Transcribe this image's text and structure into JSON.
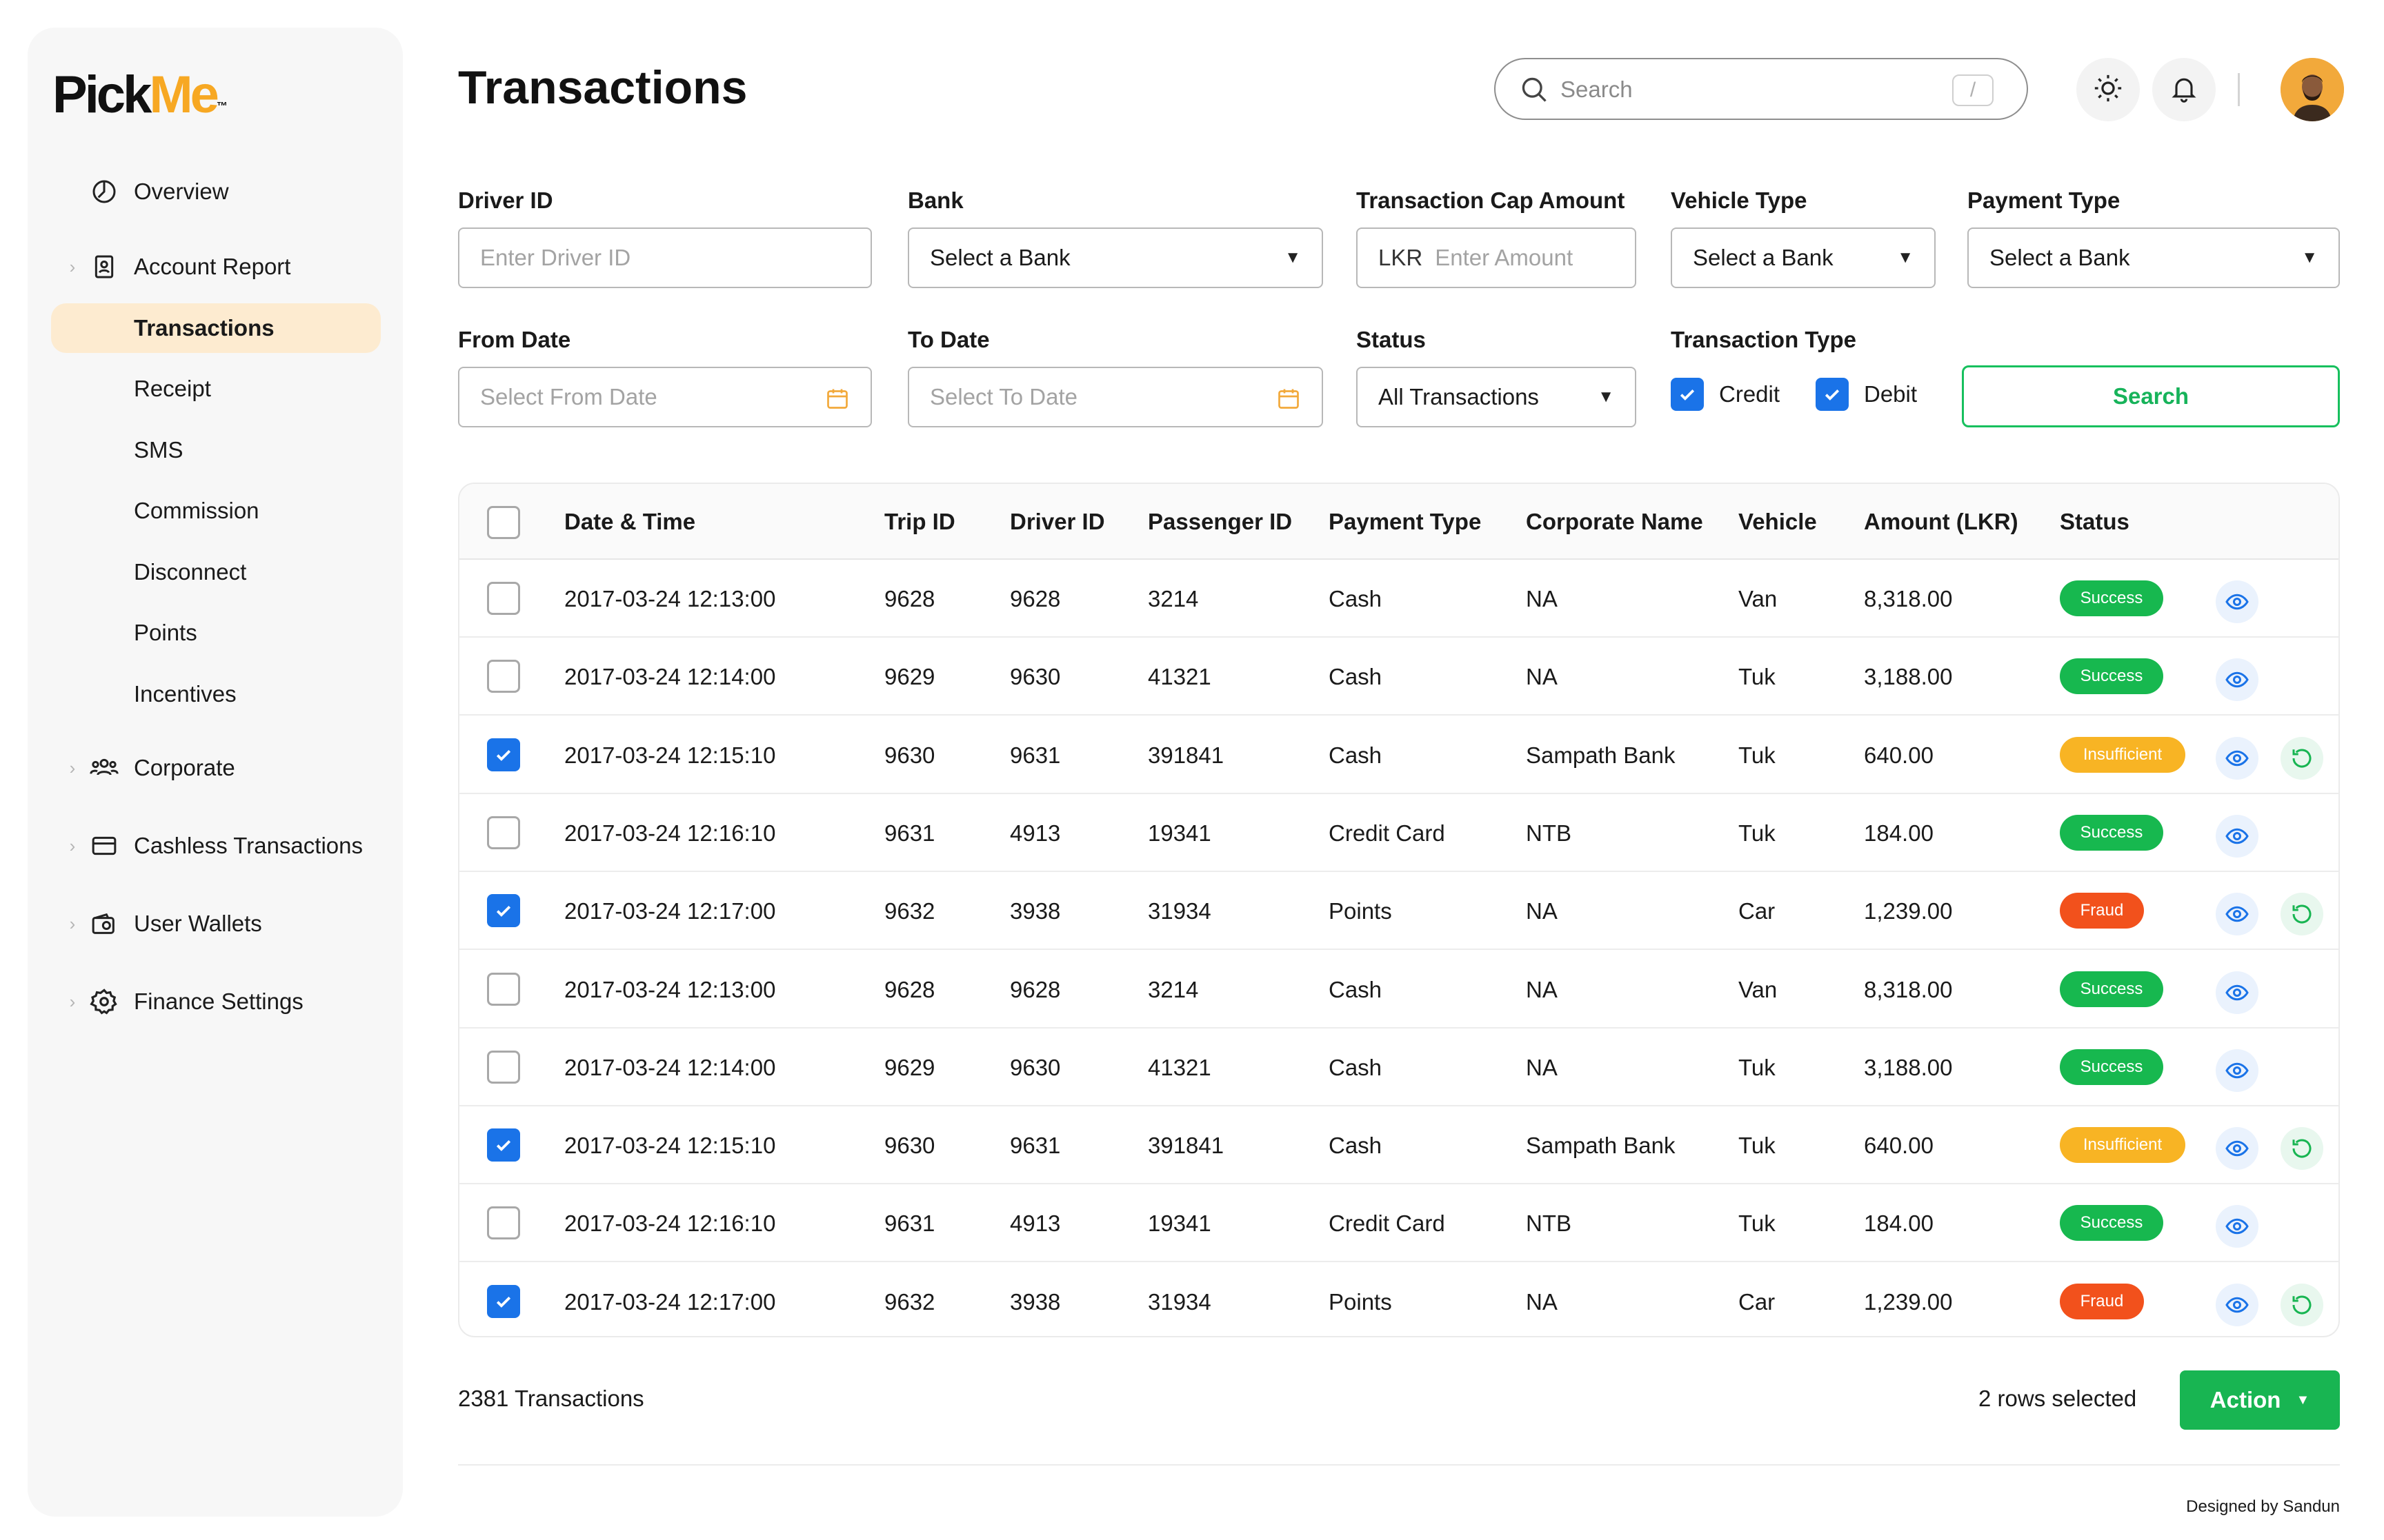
{
  "brand": {
    "logo_part1": "Pick",
    "logo_part2": "Me",
    "logo_mark": "™",
    "accent": "#f7a823"
  },
  "sidebar": {
    "items": [
      {
        "label": "Overview",
        "icon": "overview-icon"
      },
      {
        "label": "Account Report",
        "icon": "account-report-icon"
      },
      {
        "label": "Corporate",
        "icon": "corporate-icon"
      },
      {
        "label": "Cashless Transactions",
        "icon": "card-icon"
      },
      {
        "label": "User Wallets",
        "icon": "wallet-icon"
      },
      {
        "label": "Finance Settings",
        "icon": "gear-icon"
      }
    ],
    "subitems": [
      "Transactions",
      "Receipt",
      "SMS",
      "Commission",
      "Disconnect",
      "Points",
      "Incentives"
    ],
    "active": "Transactions"
  },
  "header": {
    "title": "Transactions",
    "search_placeholder": "Search",
    "search_shortcut": "/"
  },
  "filters": {
    "driver_id": {
      "label": "Driver ID",
      "placeholder": "Enter Driver ID"
    },
    "bank": {
      "label": "Bank",
      "value": "Select a Bank"
    },
    "cap_amount": {
      "label": "Transaction Cap Amount",
      "prefix": "LKR",
      "placeholder": "Enter Amount"
    },
    "vehicle_type": {
      "label": "Vehicle Type",
      "value": "Select a Bank"
    },
    "payment_type": {
      "label": "Payment Type",
      "value": "Select a Bank"
    },
    "from_date": {
      "label": "From Date",
      "placeholder": "Select From Date"
    },
    "to_date": {
      "label": "To Date",
      "placeholder": "Select To Date"
    },
    "status": {
      "label": "Status",
      "value": "All Transactions"
    },
    "transaction_type": {
      "label": "Transaction Type",
      "credit": "Credit",
      "debit": "Debit",
      "credit_checked": true,
      "debit_checked": true
    },
    "search_button": "Search"
  },
  "table": {
    "columns": [
      "Date & Time",
      "Trip ID",
      "Driver ID",
      "Passenger ID",
      "Payment Type",
      "Corporate Name",
      "Vehicle",
      "Amount (LKR)",
      "Status"
    ],
    "rows": [
      {
        "checked": false,
        "datetime": "2017-03-24 12:13:00",
        "trip_id": "9628",
        "driver_id": "9628",
        "passenger_id": "3214",
        "payment": "Cash",
        "corporate": "NA",
        "vehicle": "Van",
        "amount": "8,318.00",
        "status": "Success",
        "refund": false
      },
      {
        "checked": false,
        "datetime": "2017-03-24 12:14:00",
        "trip_id": "9629",
        "driver_id": "9630",
        "passenger_id": "41321",
        "payment": "Cash",
        "corporate": "NA",
        "vehicle": "Tuk",
        "amount": "3,188.00",
        "status": "Success",
        "refund": false
      },
      {
        "checked": true,
        "datetime": "2017-03-24 12:15:10",
        "trip_id": "9630",
        "driver_id": "9631",
        "passenger_id": "391841",
        "payment": "Cash",
        "corporate": "Sampath Bank",
        "vehicle": "Tuk",
        "amount": "640.00",
        "status": "Insufficient",
        "refund": true
      },
      {
        "checked": false,
        "datetime": "2017-03-24 12:16:10",
        "trip_id": "9631",
        "driver_id": "4913",
        "passenger_id": "19341",
        "payment": "Credit Card",
        "corporate": "NTB",
        "vehicle": "Tuk",
        "amount": "184.00",
        "status": "Success",
        "refund": false
      },
      {
        "checked": true,
        "datetime": "2017-03-24 12:17:00",
        "trip_id": "9632",
        "driver_id": "3938",
        "passenger_id": "31934",
        "payment": "Points",
        "corporate": "NA",
        "vehicle": "Car",
        "amount": "1,239.00",
        "status": "Fraud",
        "refund": true
      },
      {
        "checked": false,
        "datetime": "2017-03-24 12:13:00",
        "trip_id": "9628",
        "driver_id": "9628",
        "passenger_id": "3214",
        "payment": "Cash",
        "corporate": "NA",
        "vehicle": "Van",
        "amount": "8,318.00",
        "status": "Success",
        "refund": false
      },
      {
        "checked": false,
        "datetime": "2017-03-24 12:14:00",
        "trip_id": "9629",
        "driver_id": "9630",
        "passenger_id": "41321",
        "payment": "Cash",
        "corporate": "NA",
        "vehicle": "Tuk",
        "amount": "3,188.00",
        "status": "Success",
        "refund": false
      },
      {
        "checked": true,
        "datetime": "2017-03-24 12:15:10",
        "trip_id": "9630",
        "driver_id": "9631",
        "passenger_id": "391841",
        "payment": "Cash",
        "corporate": "Sampath Bank",
        "vehicle": "Tuk",
        "amount": "640.00",
        "status": "Insufficient",
        "refund": true
      },
      {
        "checked": false,
        "datetime": "2017-03-24 12:16:10",
        "trip_id": "9631",
        "driver_id": "4913",
        "passenger_id": "19341",
        "payment": "Credit Card",
        "corporate": "NTB",
        "vehicle": "Tuk",
        "amount": "184.00",
        "status": "Success",
        "refund": false
      },
      {
        "checked": true,
        "datetime": "2017-03-24 12:17:00",
        "trip_id": "9632",
        "driver_id": "3938",
        "passenger_id": "31934",
        "payment": "Points",
        "corporate": "NA",
        "vehicle": "Car",
        "amount": "1,239.00",
        "status": "Fraud",
        "refund": true
      }
    ],
    "status_colors": {
      "Success": "#17b84f",
      "Insufficient": "#f8b424",
      "Fraud": "#f2511c"
    }
  },
  "footer": {
    "count": "2381 Transactions",
    "selected": "2 rows selected",
    "action_label": "Action",
    "credit": "Designed by Sandun"
  }
}
